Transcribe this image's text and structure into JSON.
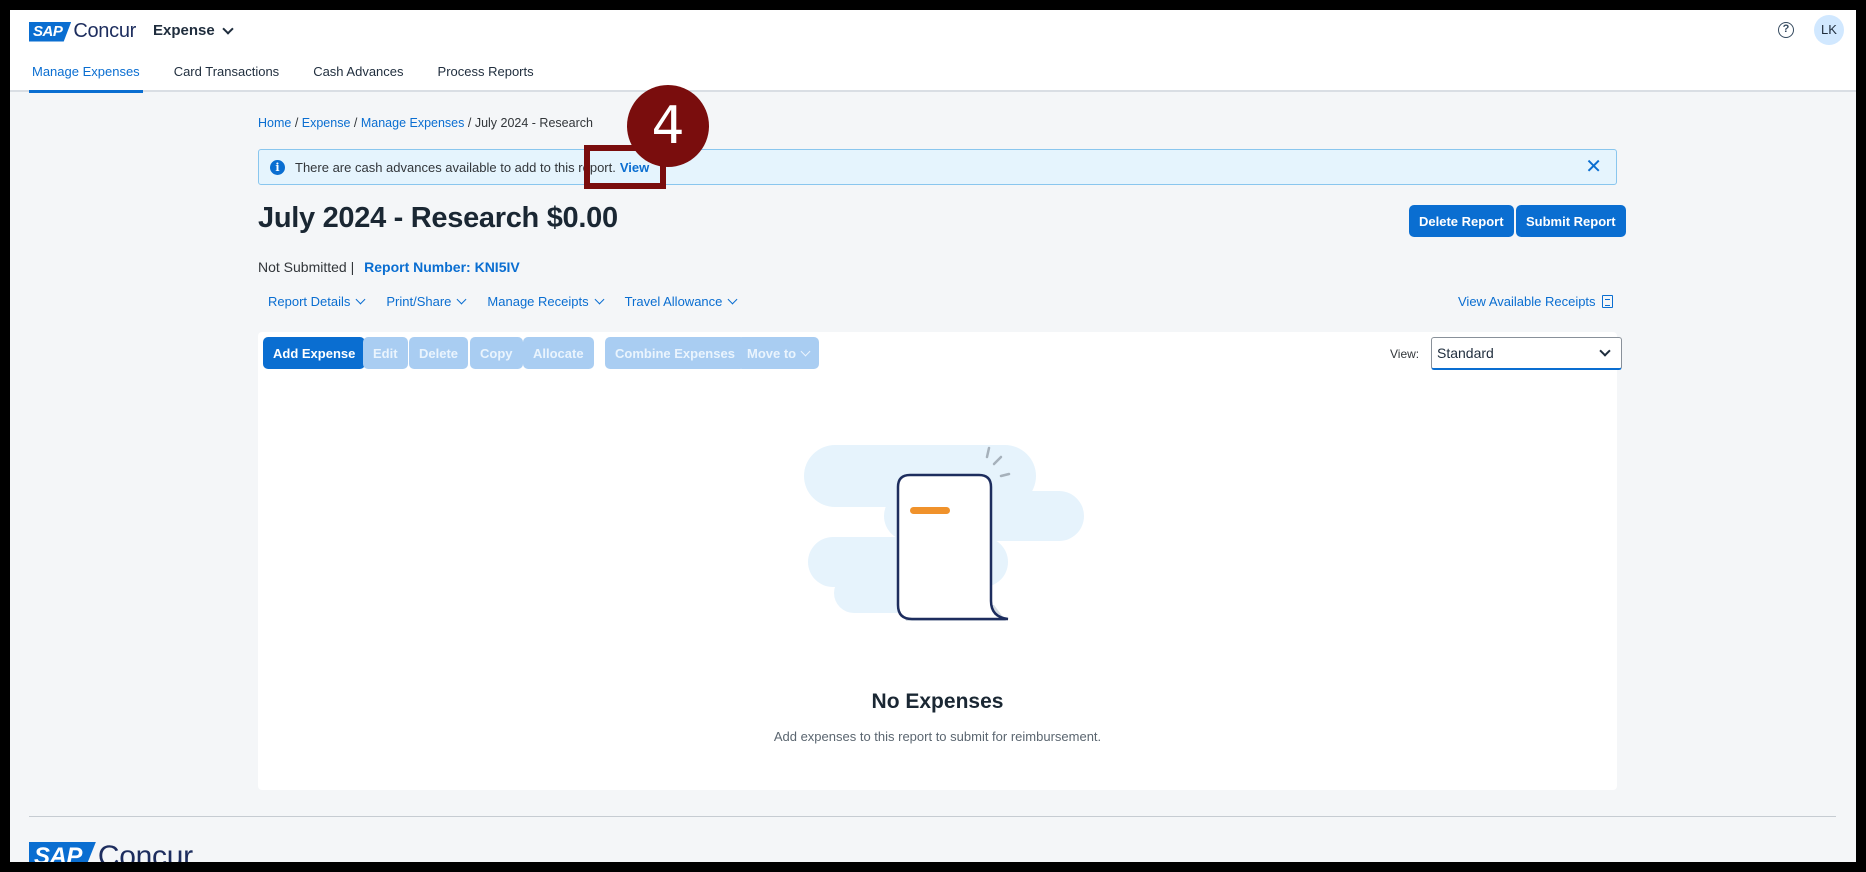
{
  "app": {
    "logo_sap": "SAP",
    "logo_concur": "Concur",
    "product_switcher": "Expense",
    "help_icon": "help-circle-icon",
    "avatar_initials": "LK"
  },
  "nav": {
    "tabs": [
      {
        "label": "Manage Expenses",
        "active": true
      },
      {
        "label": "Card Transactions",
        "active": false
      },
      {
        "label": "Cash Advances",
        "active": false
      },
      {
        "label": "Process Reports",
        "active": false
      }
    ]
  },
  "breadcrumb": {
    "items": [
      "Home",
      "Expense",
      "Manage Expenses"
    ],
    "sep": " / ",
    "current": "July 2024 - Research"
  },
  "banner": {
    "message": "There are cash advances available to add to this report.",
    "link": "View",
    "close": "✕"
  },
  "report": {
    "title": "July 2024 - Research $0.00",
    "status": "Not Submitted |",
    "number_label": "Report Number: KNI5IV",
    "delete_button": "Delete Report",
    "submit_button": "Submit Report"
  },
  "submenus": {
    "report_details": "Report Details",
    "print_share": "Print/Share",
    "manage_receipts": "Manage Receipts",
    "travel_allowance": "Travel Allowance",
    "view_receipts": "View Available Receipts"
  },
  "toolbar": {
    "add_expense": "Add Expense",
    "edit": "Edit",
    "delete": "Delete",
    "copy": "Copy",
    "allocate": "Allocate",
    "combine": "Combine Expenses",
    "move_to": "Move to",
    "view_label": "View:",
    "view_value": "Standard"
  },
  "empty_state": {
    "title": "No Expenses",
    "subtitle": "Add expenses to this report to submit for reimbursement."
  },
  "annotation": {
    "step": "4"
  },
  "colors": {
    "primary": "#0a6ed1",
    "disabled": "#a9cdf2",
    "annotation": "#7a0d0d",
    "banner_bg": "#e5f4fd"
  }
}
